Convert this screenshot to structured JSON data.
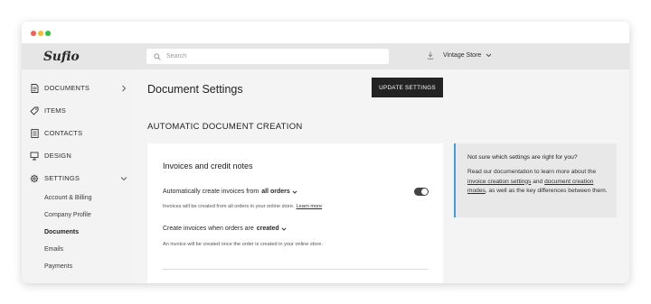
{
  "app": {
    "logo": "Sufio"
  },
  "topbar": {
    "search_placeholder": "Search",
    "store_name": "Vintage Store"
  },
  "sidebar": {
    "items": [
      {
        "label": "DOCUMENTS",
        "icon": "document-icon",
        "has_chevron": true
      },
      {
        "label": "ITEMS",
        "icon": "tag-icon"
      },
      {
        "label": "CONTACTS",
        "icon": "contacts-icon"
      },
      {
        "label": "DESIGN",
        "icon": "design-icon"
      },
      {
        "label": "SETTINGS",
        "icon": "gear-icon",
        "expanded": true
      }
    ],
    "settings_subitems": [
      {
        "label": "Account & Billing"
      },
      {
        "label": "Company Profile"
      },
      {
        "label": "Documents",
        "active": true
      },
      {
        "label": "Emails"
      },
      {
        "label": "Payments"
      }
    ]
  },
  "main": {
    "title": "Document Settings",
    "update_button": "UPDATE SETTINGS",
    "section_title": "AUTOMATIC DOCUMENT CREATION",
    "card": {
      "title": "Invoices and credit notes",
      "option1": {
        "label": "Automatically create invoices from",
        "value": "all orders",
        "description": "Invoices will be created from all orders in your online store.",
        "link": "Learn more",
        "enabled": true
      },
      "option2": {
        "label": "Create invoices when orders are",
        "value": "created",
        "description": "An invoice will be created once the order is created in your online store."
      }
    },
    "help": {
      "title": "Not sure which settings are right for you?",
      "text_before": "Read our documentation to learn more about the",
      "link1": "invoice creation settings",
      "text_and": "and",
      "link2": "document creation modes",
      "text_after": ", as well as the key differences between them."
    }
  },
  "colors": {
    "accent": "#3f9fe0",
    "button_bg": "#232323"
  }
}
